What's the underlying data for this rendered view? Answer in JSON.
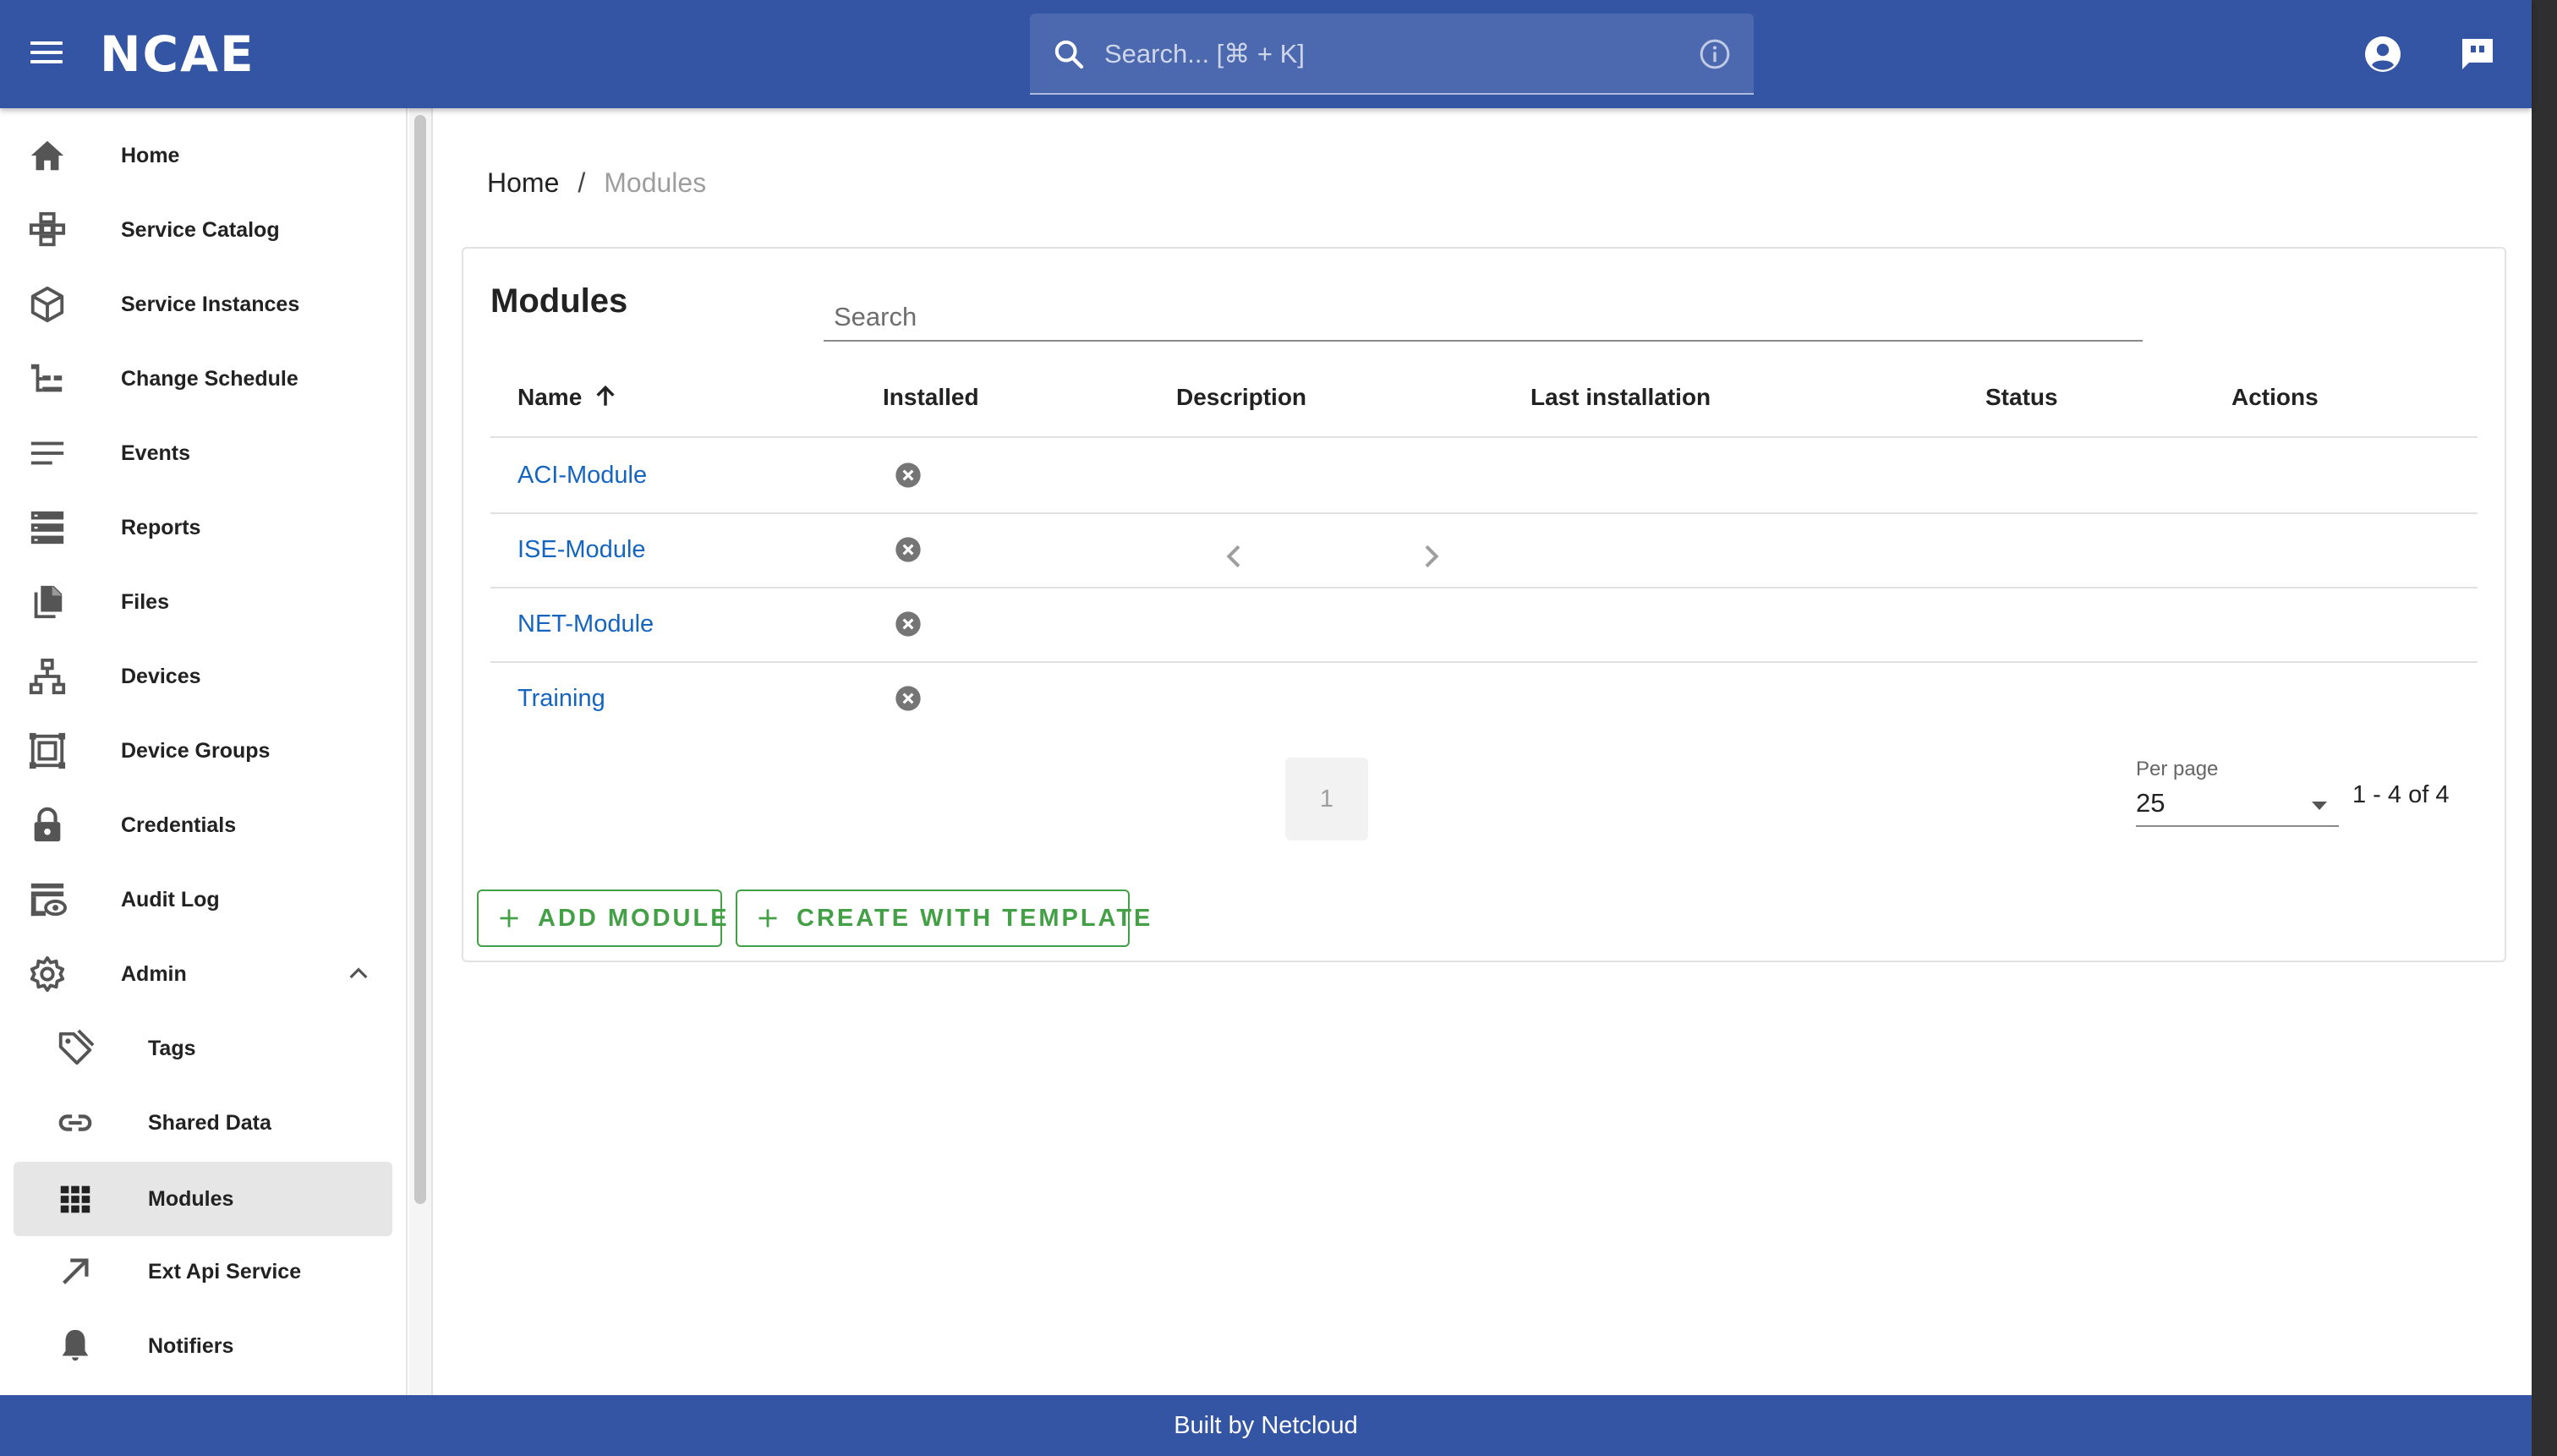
{
  "header": {
    "logo": "NCAE",
    "search_placeholder": "Search... [⌘ + K]",
    "icons": [
      "menu-icon",
      "search-icon",
      "info-icon",
      "account-icon",
      "feedback-icon"
    ]
  },
  "sidebar": {
    "items": [
      {
        "label": "Home",
        "icon": "home-icon"
      },
      {
        "label": "Service Catalog",
        "icon": "catalog-icon"
      },
      {
        "label": "Service Instances",
        "icon": "cube-icon"
      },
      {
        "label": "Change Schedule",
        "icon": "schedule-icon"
      },
      {
        "label": "Events",
        "icon": "lines-icon"
      },
      {
        "label": "Reports",
        "icon": "reports-icon"
      },
      {
        "label": "Files",
        "icon": "files-icon"
      },
      {
        "label": "Devices",
        "icon": "network-icon"
      },
      {
        "label": "Device Groups",
        "icon": "device-groups-icon"
      },
      {
        "label": "Credentials",
        "icon": "lock-icon"
      },
      {
        "label": "Audit Log",
        "icon": "audit-icon"
      },
      {
        "label": "Admin",
        "icon": "gear-icon"
      }
    ],
    "admin_sub": [
      {
        "label": "Tags",
        "icon": "tag-icon"
      },
      {
        "label": "Shared Data",
        "icon": "link-icon"
      },
      {
        "label": "Modules",
        "icon": "grid-icon"
      },
      {
        "label": "Ext Api Service",
        "icon": "arrow-up-right-icon"
      },
      {
        "label": "Notifiers",
        "icon": "bell-icon"
      }
    ]
  },
  "breadcrumb": {
    "home": "Home",
    "separator": "/",
    "current": "Modules"
  },
  "card": {
    "title": "Modules",
    "search_placeholder": "Search",
    "columns": [
      "Name",
      "Installed",
      "Description",
      "Last installation",
      "Status",
      "Actions"
    ],
    "rows": [
      {
        "name": "ACI-Module"
      },
      {
        "name": "ISE-Module"
      },
      {
        "name": "NET-Module"
      },
      {
        "name": "Training"
      }
    ],
    "pagination": {
      "page": "1",
      "per_page_label": "Per page",
      "per_page": "25",
      "range": "1 - 4 of 4"
    },
    "buttons": {
      "add": "ADD MODULE",
      "template": "CREATE WITH TEMPLATE"
    }
  },
  "footer": {
    "text": "Built by Netcloud"
  },
  "colors": {
    "primary": "#3455a4",
    "link": "#1565c0",
    "success": "#43a047"
  }
}
